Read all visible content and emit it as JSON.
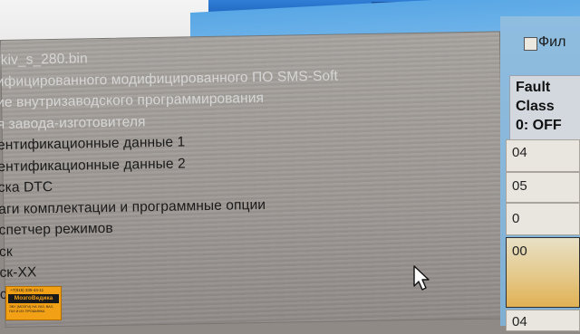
{
  "window": {
    "close_glyph": "✕"
  },
  "options_panel": {
    "items": [
      {
        "label": "rkiv_s_280.bin"
      },
      {
        "label": "ифицированного модифицированного ПО SMS-Soft"
      },
      {
        "label": "ие внутризаводского программирования"
      },
      {
        "label": "я завода-изготовителя"
      },
      {
        "label": "ентификационные данные 1"
      },
      {
        "label": "ентификационные данные 2"
      },
      {
        "label": "ска DTC"
      },
      {
        "label": "аги комплектации и программные опции"
      },
      {
        "label": "спетчер режимов"
      },
      {
        "label": "ск"
      },
      {
        "label": "ск-XX"
      },
      {
        "label": "с"
      }
    ]
  },
  "filter": {
    "label": "Фил"
  },
  "fault_table": {
    "header_lines": [
      "Fault",
      "Class",
      "0: OFF"
    ],
    "cells": [
      "04",
      "05",
      "0",
      "00",
      "04"
    ]
  },
  "logo": {
    "phone": "+7(915) 335-44-11",
    "name": "МозгоВедика",
    "subtitle": "ЭБУ (МОЗГИ) НА УАЗ, ВАЗ, ГАЗ И ИХ ПРОШИВКА"
  },
  "colors": {
    "title_blue": "#1e5fb8",
    "highlight_row": "#e1b155",
    "panel_gray": "#a6a29e"
  },
  "icons": {
    "cursor": "arrow-cursor-icon",
    "checkbox": "checkbox-icon",
    "close": "close-icon"
  }
}
